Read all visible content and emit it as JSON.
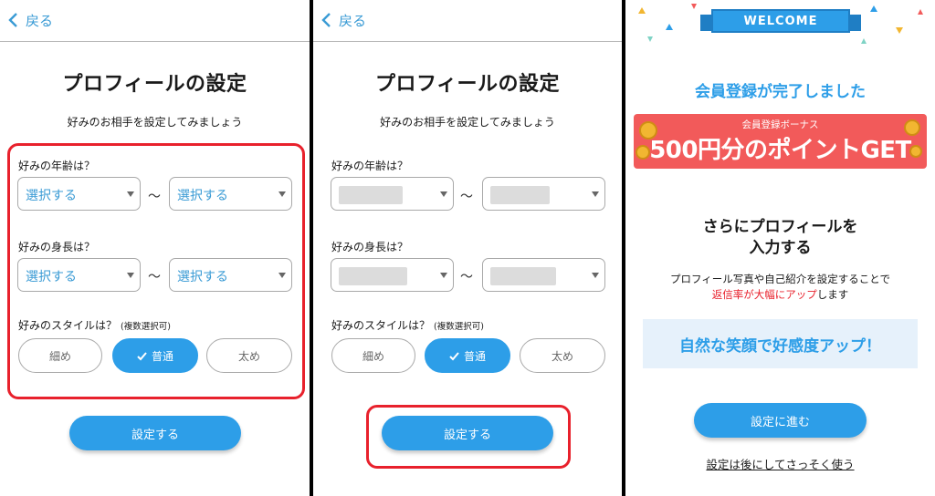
{
  "common": {
    "back_label": "戻る",
    "title": "プロフィールの設定",
    "subtitle": "好みのお相手を設定してみましょう",
    "age_label": "好みの年齢は？",
    "height_label": "好みの身長は？",
    "style_label": "好みのスタイルは？",
    "style_note": "(複数選択可)",
    "range_separator": "～",
    "styles": [
      "細め",
      "普通",
      "太め"
    ],
    "selected_style": "普通",
    "submit_label": "設定する"
  },
  "screen1": {
    "age_from": "選択する",
    "age_to": "選択する",
    "height_from": "選択する",
    "height_to": "選択する"
  },
  "screen3": {
    "banner": "WELCOME",
    "complete_message": "会員登録が完了しました",
    "bonus_caption": "会員登録ボーナス",
    "bonus_headline": "500円分のポイントGET",
    "heading_line1": "さらにプロフィールを",
    "heading_line2": "入力する",
    "desc_line1": "プロフィール写真や自己紹介を設定することで",
    "desc_highlight": "返信率が大幅にアップ",
    "desc_tail": "します",
    "smile_text": "自然な笑顔で好感度アップ！",
    "proceed_label": "設定に進む",
    "later_label": "設定は後にしてさっそく使う"
  },
  "colors": {
    "accent": "#2d9ee8",
    "highlight_red": "#e8212c",
    "bonus_red": "#f25a5a",
    "coin_gold": "#f2b631"
  },
  "icons": [
    "chevron-left-icon",
    "caret-down-icon",
    "check-icon",
    "coin-icon"
  ]
}
